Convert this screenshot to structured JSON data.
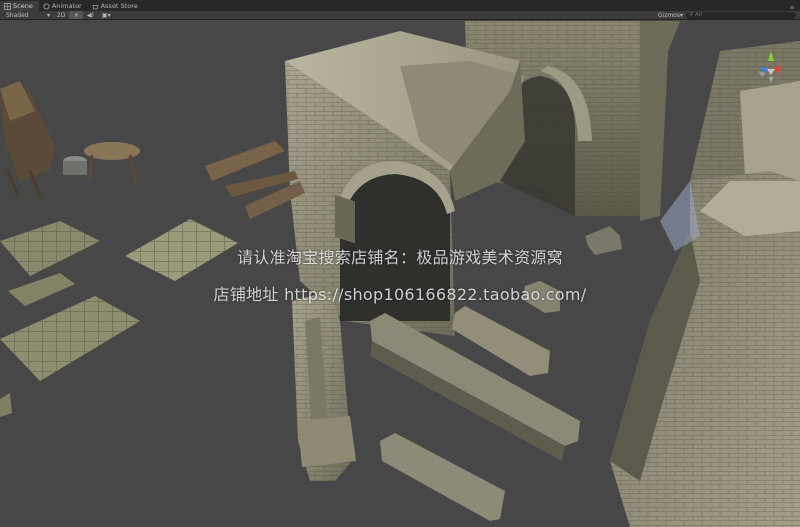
{
  "tabs": [
    {
      "label": "Scene",
      "icon": "scene-grid-icon",
      "active": true
    },
    {
      "label": "Animator",
      "icon": "animator-icon",
      "active": false
    },
    {
      "label": "Asset Store",
      "icon": "store-icon",
      "active": false
    }
  ],
  "toolbar": {
    "shading_mode": "Shaded",
    "mode_2d": "2D",
    "lighting_icon": "sun-icon",
    "audio_icon": "speaker-icon",
    "effects_icon": "image-icon",
    "gizmos_label": "Gizmos",
    "search_placeholder": "All"
  },
  "gizmo": {
    "y_label": "y",
    "x_label": "x"
  },
  "watermark": {
    "line1": "请认准淘宝搜索店铺名：极品游戏美术资源窝",
    "line2": "店铺地址 https://shop106166822.taobao.com/"
  },
  "colors": {
    "viewport_bg": "#474747",
    "tabbar_bg": "#282828",
    "toolbar_bg": "#3c3c3c",
    "gizmo_y": "#7ed036",
    "gizmo_x": "#e0433a",
    "gizmo_z": "#3f7ee8"
  }
}
